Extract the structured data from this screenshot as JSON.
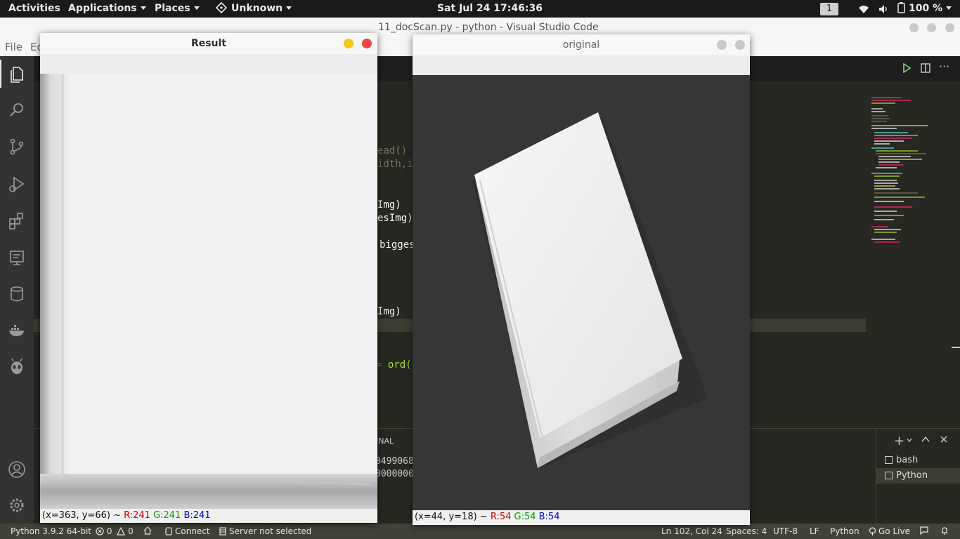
{
  "topbar": {
    "activities": "Activities",
    "applications": "Applications",
    "places": "Places",
    "network_label": "Unknown",
    "clock": "Sat Jul 24  17:46:36",
    "workspace": "1",
    "battery": "100 %"
  },
  "vscode": {
    "title": "11_docScan.py - python - Visual Studio Code",
    "menu": [
      "File",
      "Ed"
    ],
    "code_lines": [
      "ead()",
      "idth,in",
      "Img)",
      "esImg)",
      "biggesi",
      "Img)"
    ],
    "code_ord": "ord(",
    "code_eq": "=",
    "panel_tab": "INAL",
    "terminal_lines": [
      "0499068",
      "0000000"
    ],
    "terminals": [
      "bash",
      "Python"
    ],
    "status": {
      "interpreter": "Python 3.9.2 64-bit",
      "errors": "0",
      "warnings": "0",
      "connect": "Connect",
      "server": "Server not selected",
      "position": "Ln 102, Col 24",
      "spaces": "Spaces: 4",
      "encoding": "UTF-8",
      "eol": "LF",
      "language": "Python",
      "golive": "Go Live"
    },
    "settings_badge": "1"
  },
  "result_window": {
    "title": "Result",
    "status_prefix": "(x=363, y=66) ~ ",
    "r": "R:241",
    "g": "G:241",
    "b": "B:241"
  },
  "original_window": {
    "title": "original",
    "status_prefix": "(x=44, y=18) ~ ",
    "r": "R:54",
    "g": "G:54",
    "b": "B:54"
  },
  "colors": {
    "topbar_bg": "#1a1a1a",
    "editor_bg": "#272822",
    "statusbar_bg": "#414339",
    "close_red": "#f04545",
    "minimize_yellow": "#f5c518"
  }
}
